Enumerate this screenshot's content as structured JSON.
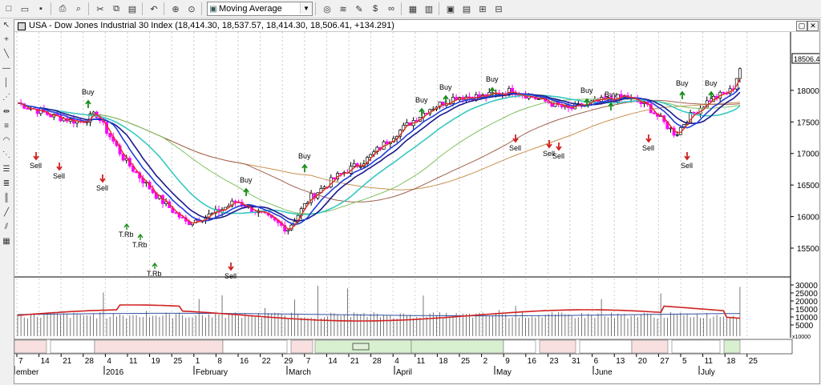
{
  "toolbar": {
    "indicator_select": "Moving Average",
    "icons": [
      "new-icon",
      "open-icon",
      "save-icon",
      "print-icon",
      "print-preview-icon",
      "cut-icon",
      "copy-icon",
      "paste-icon",
      "undo-icon",
      "crosshair-icon",
      "zoom-icon",
      "indicator-icon",
      "money-icon",
      "edit-icon",
      "dollar-icon",
      "binoculars-icon",
      "table-icon",
      "chart-icon",
      "window-icon",
      "layout-icon",
      "grid-icon",
      "tile-icon"
    ]
  },
  "chart": {
    "title": "USA - Dow Jones Industrial 30 Index (18,414.30, 18,537.57, 18,414.30, 18,506.41, +134.291)",
    "last_price": "18506.41",
    "y_ticks": [
      "18000",
      "17500",
      "17000",
      "16500",
      "16000",
      "15500"
    ],
    "volume_ticks": [
      "30000",
      "25000",
      "20000",
      "15000",
      "10000",
      "5000"
    ],
    "volume_unit": "x10000",
    "date_ticks": [
      "7",
      "14",
      "21",
      "28",
      "4",
      "11",
      "19",
      "25",
      "1",
      "8",
      "16",
      "22",
      "29",
      "7",
      "14",
      "21",
      "28",
      "4",
      "11",
      "18",
      "25",
      "2",
      "9",
      "16",
      "23",
      "31",
      "6",
      "13",
      "20",
      "27",
      "5",
      "11",
      "18",
      "25"
    ],
    "month_labels": [
      "ember",
      "2016",
      "February",
      "March",
      "April",
      "May",
      "June",
      "July"
    ],
    "signals": [
      {
        "label": "Sell",
        "type": "sell"
      },
      {
        "label": "Sell",
        "type": "sell"
      },
      {
        "label": "Buy",
        "type": "buy"
      },
      {
        "label": "Sell",
        "type": "sell"
      },
      {
        "label": "T.Rb",
        "type": "trb"
      },
      {
        "label": "T.Rb",
        "type": "trb"
      },
      {
        "label": "T.Rb",
        "type": "trb"
      },
      {
        "label": "Sell",
        "type": "sell"
      },
      {
        "label": "Buy",
        "type": "buy"
      },
      {
        "label": "Buy",
        "type": "buy"
      },
      {
        "label": "Buy",
        "type": "buy"
      },
      {
        "label": "Buy",
        "type": "buy"
      },
      {
        "label": "Buy",
        "type": "buy"
      },
      {
        "label": "Sell",
        "type": "sell"
      },
      {
        "label": "Sell",
        "type": "sell"
      },
      {
        "label": "Sell",
        "type": "sell"
      },
      {
        "label": "Buy",
        "type": "buy"
      },
      {
        "label": "Buy",
        "type": "buy"
      },
      {
        "label": "Sell",
        "type": "sell"
      },
      {
        "label": "Buy",
        "type": "buy"
      },
      {
        "label": "Sell",
        "type": "sell"
      },
      {
        "label": "Buy",
        "type": "buy"
      }
    ],
    "colors": {
      "ma_red": "#e0301e",
      "ma_navy": "#1a1a8c",
      "ma_blue": "#1f3fd8",
      "ma_teal": "#38c8c0",
      "ma_green": "#80c060",
      "ma_brown": "#a06050",
      "ma_tan": "#c89050",
      "bull": "#ffffff",
      "bear": "#ff00ff",
      "buy_arrow": "#1a8c1a",
      "sell_arrow": "#d02020",
      "vol_line": "#d02020"
    }
  }
}
